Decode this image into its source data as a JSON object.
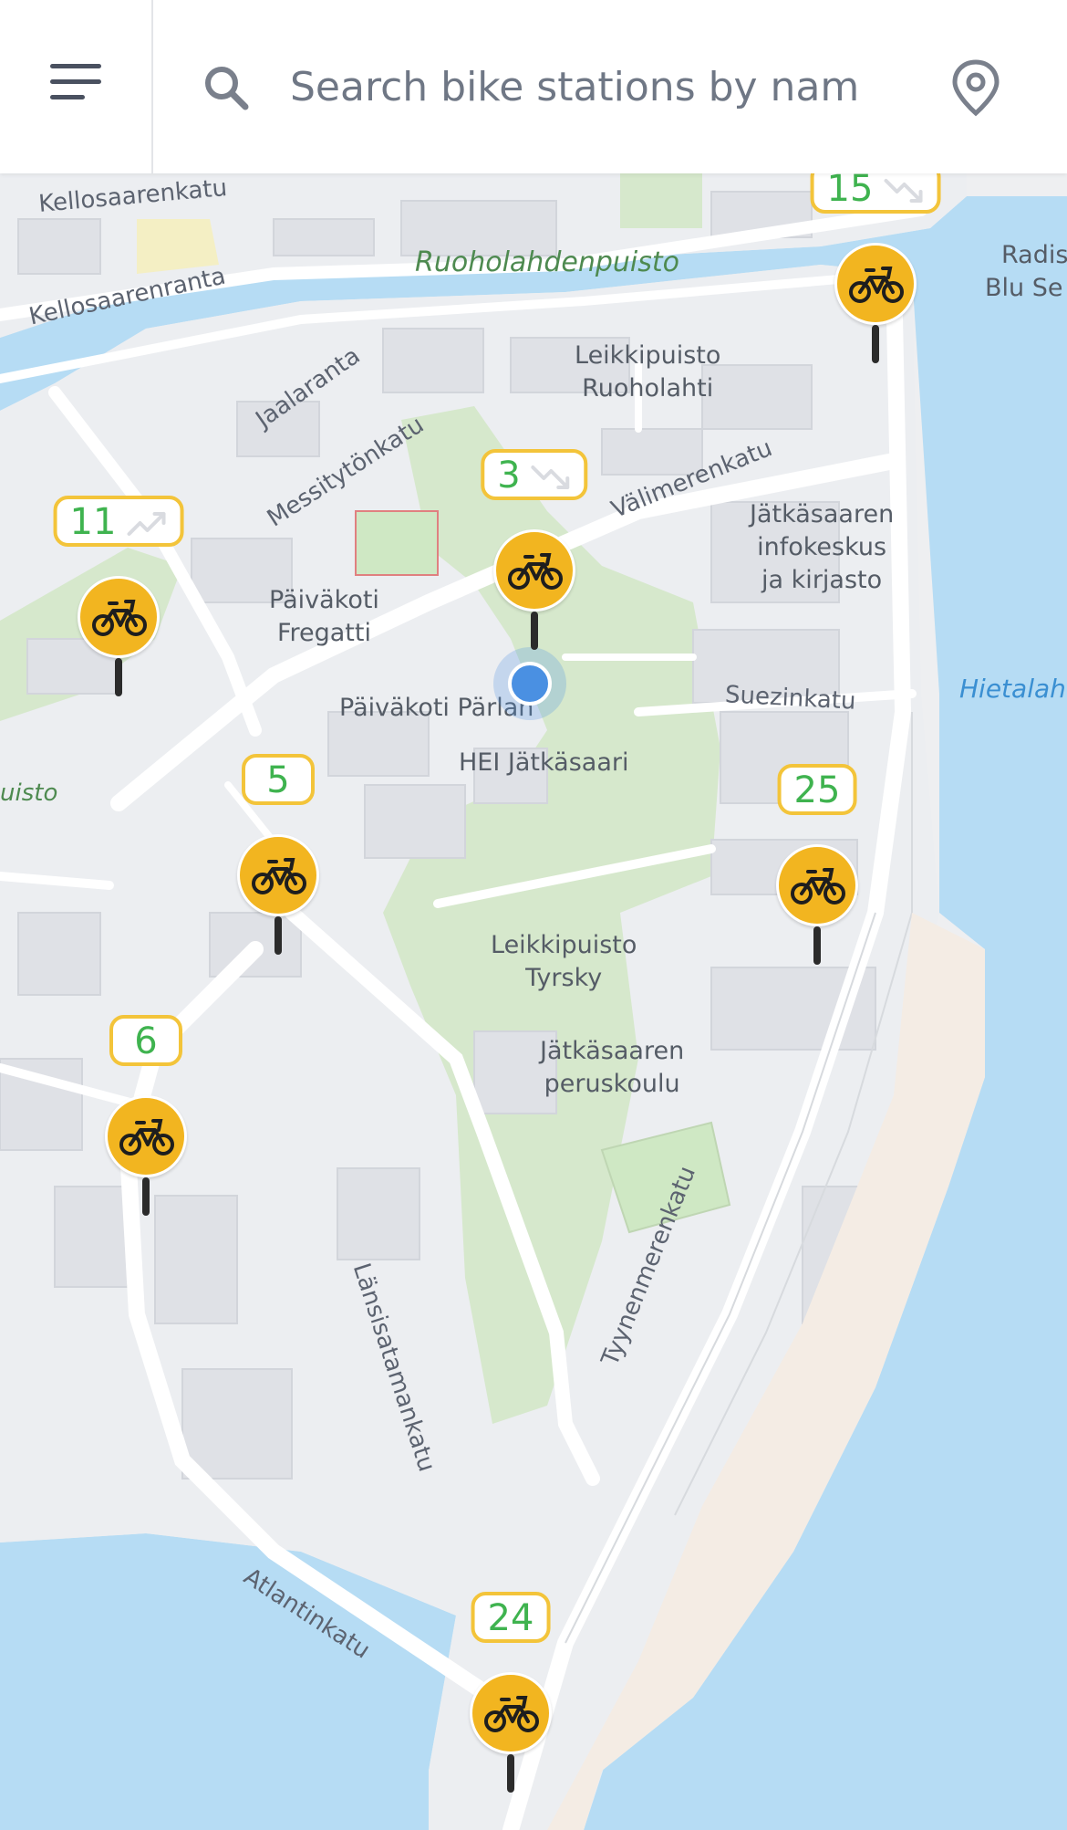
{
  "search": {
    "placeholder": "Search bike stations by name"
  },
  "icons": {
    "menu": "menu-icon",
    "search": "search-icon",
    "locate": "location-pin-icon",
    "bike": "bike-icon",
    "trend_up": "trend-up-icon",
    "trend_down": "trend-down-icon"
  },
  "colors": {
    "accent": "#f2b520",
    "count_green": "#3fb34f",
    "water": "#b6dcf4",
    "park": "#cfe5c3",
    "user_location": "#4a90e2"
  },
  "map_labels": {
    "kellosaarenkatu": "Kellosaarenkatu",
    "kellosaarenranta": "Kellosaarenranta",
    "ruoholahdenpuisto": "Ruoholahdenpuisto",
    "radis": "Radis",
    "blu_se": "Blu Se",
    "leikkipuisto_ruoholahti": "Leikkipuisto\nRuoholahti",
    "jaalaranta": "Jaalaranta",
    "messitytonkatu": "Messitytönkatu",
    "valimerenkatu": "Välimerenkatu",
    "infokeskus": "Jätkäsaaren\ninfokeskus\nja kirjasto",
    "paivakoti_fregatti": "Päiväkoti\nFregatti",
    "paivakoti_parlan": "Päiväkoti Pärlan",
    "suezinkatu": "Suezinkatu",
    "hietalahti": "Hietalah",
    "puisto": "uisto",
    "hei_jatkasaari": "HEI Jätkäsaari",
    "leikkipuisto_tyrsky": "Leikkipuisto\nTyrsky",
    "peruskoulu": "Jätkäsaaren\nperuskoulu",
    "lansisatamankatu": "Länsisatamankatu",
    "tyynenmerenkatu": "Tyynenmerenkatu",
    "atlantinkatu": "Atlantinkatu"
  },
  "stations": [
    {
      "id": "s15",
      "count": "15",
      "trend": "down"
    },
    {
      "id": "s3",
      "count": "3",
      "trend": "down"
    },
    {
      "id": "s11",
      "count": "11",
      "trend": "up"
    },
    {
      "id": "s5",
      "count": "5",
      "trend": ""
    },
    {
      "id": "s25",
      "count": "25",
      "trend": ""
    },
    {
      "id": "s6",
      "count": "6",
      "trend": ""
    },
    {
      "id": "s24",
      "count": "24",
      "trend": ""
    }
  ]
}
